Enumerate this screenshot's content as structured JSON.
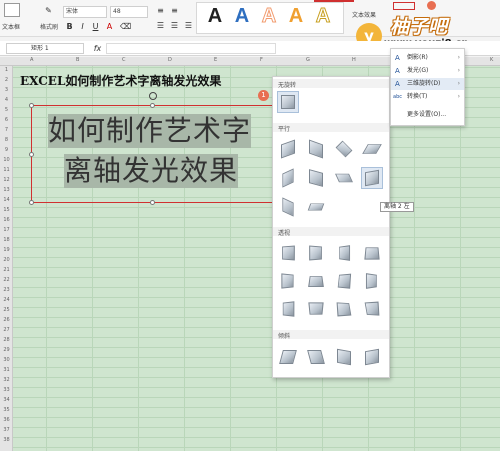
{
  "ribbon": {
    "textbox_label": "文本框",
    "format_painter_label": "格式刷",
    "font_name": "宋体",
    "font_size": "48",
    "text_effect_label": "文本效果",
    "style_letters": [
      "A",
      "A",
      "A",
      "A",
      "A"
    ],
    "style_colors": [
      "#222222",
      "#2f6fc0",
      "#f29b6e",
      "#f0a030",
      "#c8a020"
    ]
  },
  "formula_bar": {
    "name_box": "矩形 1"
  },
  "sheet": {
    "columns": [
      "A",
      "B",
      "C",
      "D",
      "E",
      "F",
      "G",
      "H",
      "I",
      "J",
      "K"
    ],
    "rows": [
      "1",
      "2",
      "3",
      "4",
      "5",
      "6",
      "7",
      "8",
      "9",
      "10",
      "11",
      "12",
      "13",
      "14",
      "15",
      "16",
      "17",
      "18",
      "19",
      "20",
      "21",
      "22",
      "23",
      "24",
      "25",
      "26",
      "27",
      "28",
      "29",
      "30",
      "31",
      "32",
      "33",
      "34",
      "35",
      "36",
      "37",
      "38"
    ],
    "heading": "EXCEL如何制作艺术字离轴发光效果"
  },
  "textbox": {
    "line1": "如何制作艺术字",
    "line2": "离轴发光效果",
    "badge": "1"
  },
  "panel": {
    "sections": [
      "无旋转",
      "平行",
      "透视",
      "倾斜"
    ]
  },
  "tooltip": "离轴 2 左",
  "submenu": {
    "items": [
      {
        "label": "倒影(R)",
        "icon": "A",
        "arrow": "›"
      },
      {
        "label": "发光(G)",
        "icon": "A",
        "arrow": "›"
      },
      {
        "label": "三维旋转(D)",
        "icon": "A",
        "arrow": "›"
      },
      {
        "label": "转换(T)",
        "icon": "abc",
        "arrow": "›"
      },
      {
        "label": "更多设置(O)...",
        "icon": "",
        "arrow": ""
      }
    ]
  },
  "watermark": {
    "logo": "y",
    "title": "柚子吧",
    "url": "www.youzi8.cn"
  }
}
